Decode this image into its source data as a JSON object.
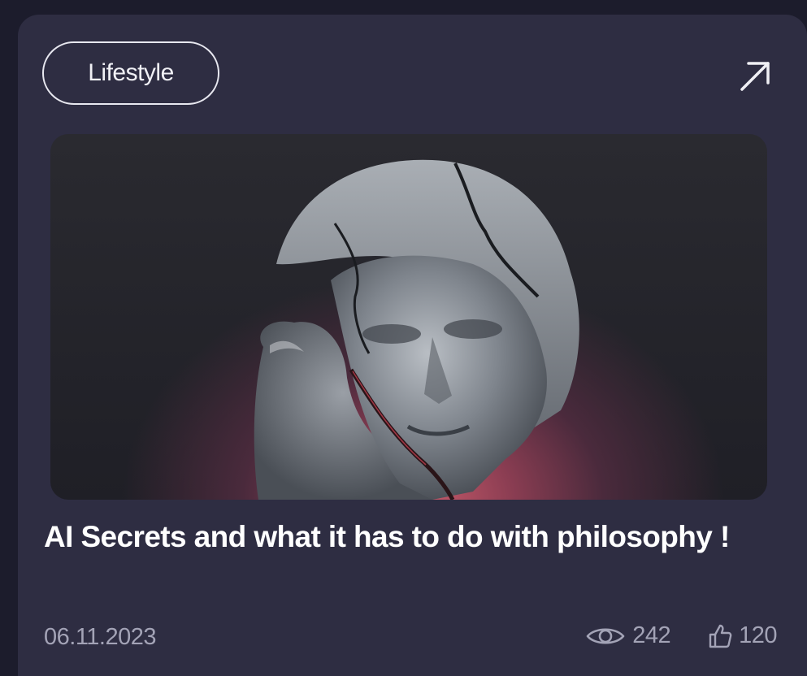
{
  "card": {
    "category": "Lifestyle",
    "open_icon": "arrow-up-right-icon",
    "image_alt": "Cracked marble bust with a second face behind it on a red-glow background",
    "title": "AI Secrets and what it has to do with philosophy !",
    "date": "06.11.2023",
    "views": "242",
    "views_icon": "eye-icon",
    "likes": "120",
    "likes_icon": "thumbs-up-icon"
  },
  "colors": {
    "page_background": "#1c1c2c",
    "card_background": "#2e2d42",
    "title_text": "#ffffff",
    "meta_text": "#a3a3b6",
    "glow": "#c75a6a"
  }
}
